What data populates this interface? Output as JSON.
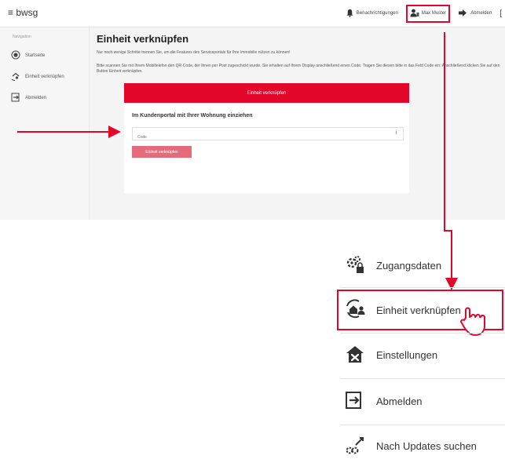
{
  "app": {
    "brand": "≡ bwsg"
  },
  "topnav": {
    "notifications": "Benachrichtigungen",
    "user": "Max Muster",
    "logout": "Abmelden",
    "extra": "["
  },
  "sidebar": {
    "title": "Navigation",
    "items": [
      {
        "label": "Startseite",
        "icon": "home-circle-icon"
      },
      {
        "label": "Einheit verknüpfen",
        "icon": "link-unit-icon"
      },
      {
        "label": "Abmelden",
        "icon": "logout-icon"
      }
    ]
  },
  "main": {
    "title": "Einheit verknüpfen",
    "intro": "Nur noch wenige Schritte trennen Sie, um die Features des Serviceportals für Ihre Immobilie nützen zu können!",
    "instructions": "Bitte scannen Sie mit Ihrem Mobiltelefon den QR-Code, der Ihnen per Post zugeschickt wurde. Sie erhalten auf Ihrem Display anschließend einen Code. Tragen Sie diesen bitte in das Feld Code ein. Anschließend klicken Sie auf den Button Einheit verknüpfen.",
    "card": {
      "header": "Einheit verknüpfen",
      "section_title": "Im Kundenportal mit Ihrer Wohnung einziehen",
      "code_placeholder": "Code",
      "info": "i",
      "button": "Einheit verknüpfen"
    }
  },
  "menu": {
    "items": [
      {
        "label": "Zugangsdaten",
        "icon": "gear-lock-icon"
      },
      {
        "label": "Einheit verknüpfen",
        "icon": "home-user-sync-icon"
      },
      {
        "label": "Einstellungen",
        "icon": "house-tools-icon"
      },
      {
        "label": "Abmelden",
        "icon": "logout-icon"
      },
      {
        "label": "Nach Updates suchen",
        "icon": "gears-update-icon"
      }
    ]
  },
  "colors": {
    "accent": "#e3062b",
    "button_soft": "#e36b7b"
  }
}
